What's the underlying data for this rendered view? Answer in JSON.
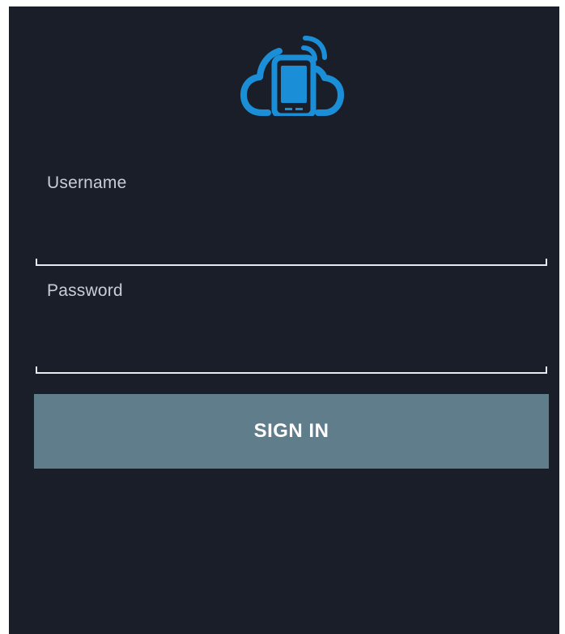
{
  "theme": {
    "background": "#1a1e29",
    "accent": "#1a8fd8",
    "button": "#607d8b",
    "text": "#ffffff"
  },
  "logo": {
    "icon": "cloud-phone-wifi-icon"
  },
  "form": {
    "username": {
      "label": "Username",
      "value": ""
    },
    "password": {
      "label": "Password",
      "value": ""
    },
    "signin_label": "SIGN IN"
  }
}
